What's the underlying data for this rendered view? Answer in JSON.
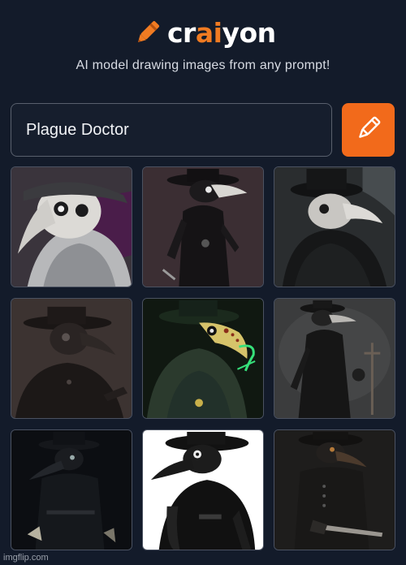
{
  "app": {
    "logo_pre": "cr",
    "logo_mid": "ai",
    "logo_post": "yon",
    "tagline": "AI model drawing images from any prompt!"
  },
  "prompt": {
    "value": "Plague Doctor"
  },
  "draw_button": {
    "icon": "pencil-icon",
    "color": "#f26a1b"
  },
  "colors": {
    "background": "#131b2a",
    "accent": "#f07b22"
  },
  "results": {
    "count": 9,
    "images": [
      {
        "name": "plague-doctor-1"
      },
      {
        "name": "plague-doctor-2"
      },
      {
        "name": "plague-doctor-3"
      },
      {
        "name": "plague-doctor-4"
      },
      {
        "name": "plague-doctor-5"
      },
      {
        "name": "plague-doctor-6"
      },
      {
        "name": "plague-doctor-7"
      },
      {
        "name": "plague-doctor-8"
      },
      {
        "name": "plague-doctor-9"
      }
    ]
  },
  "watermark": "imgflip.com"
}
